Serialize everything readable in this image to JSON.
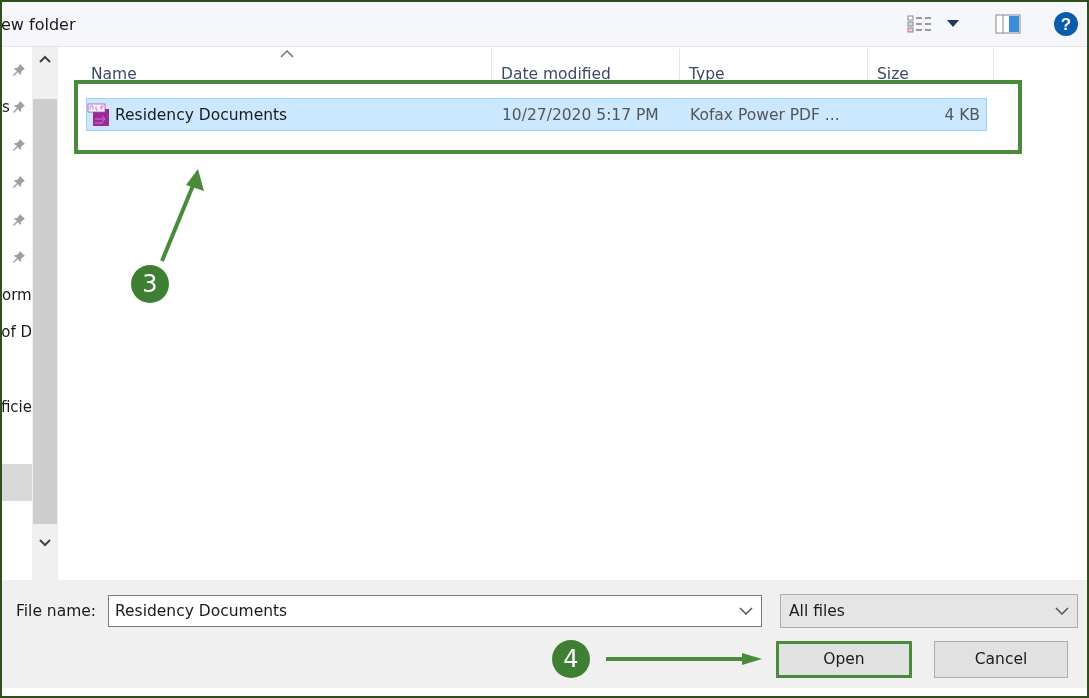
{
  "toolbar": {
    "new_folder": "ew folder",
    "help": "?"
  },
  "nav_items": [
    {
      "pinned": true,
      "selected": false
    },
    {
      "text": "s",
      "pinned": true,
      "selected": false
    },
    {
      "pinned": true,
      "selected": false
    },
    {
      "pinned": true,
      "selected": false
    },
    {
      "pinned": true,
      "selected": false
    },
    {
      "pinned": true,
      "selected": false
    },
    {
      "text": "orm",
      "pinned": false,
      "selected": false
    },
    {
      "text": "of D",
      "pinned": false,
      "selected": false
    },
    {
      "pinned": false,
      "selected": false
    },
    {
      "text": "ficie",
      "pinned": false,
      "selected": false
    },
    {
      "pinned": false,
      "selected": false
    },
    {
      "pinned": false,
      "selected": true
    }
  ],
  "columns": [
    "Name",
    "Date modified",
    "Type",
    "Size"
  ],
  "files": [
    {
      "name": "Residency Documents",
      "date": "10/27/2020 5:17 PM",
      "type": "Kofax Power PDF ...",
      "size": "4 KB",
      "selected": true
    }
  ],
  "callouts": [
    {
      "number": "3"
    },
    {
      "number": "4"
    }
  ],
  "file_name": {
    "label": "File name:",
    "value": "Residency Documents"
  },
  "filter": "All files",
  "buttons": [
    {
      "label": "Open",
      "highlighted": true
    },
    {
      "label": "Cancel",
      "highlighted": false
    }
  ]
}
